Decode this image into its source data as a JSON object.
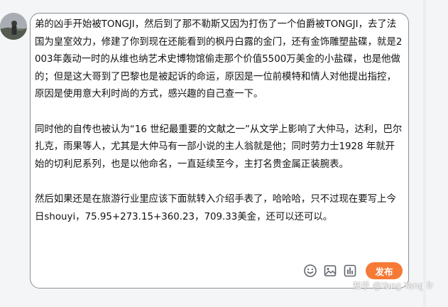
{
  "editor": {
    "paragraphs": [
      "弟的凶手开始被TONGJI，然后到了那不勒斯又因为打伤了一个伯爵被TONGJI，去了法国为皇室效力，修建了你到现在还能看到的枫丹白露的金门，还有金饰雕塑盐碟，就是2003年轰动一时的从维也纳艺术史博物馆偷走那个价值5500万美金的小盐碟，也是他做的；但是这大哥到了巴黎也是被起诉的命运，原因是一位前模特和情人对他提出指控，原因是使用意大利时尚的方式，感兴趣的自己查一下。",
      "同时他的自传也被认为“16 世纪最重要的文献之一”从文学上影响了大仲马，达利，巴尔扎克，雨果等人，尤其是大仲马有一部小说的主人翁就是他；同时劳力士1928 年就开始的切利尼系列，也是以他命名，一直延续至今，主打名贵金属正装腕表。",
      "然后如果还是在旅游行业里应该下面就转入介绍手表了，哈哈哈，只不过现在要写上今日shouyi，75.95+273.15+360.23，709.33美金，还可以还可以。"
    ]
  },
  "toolbar": {
    "icons": [
      "emoji-icon",
      "image-icon",
      "chart-icon"
    ],
    "publish_label": "发布"
  },
  "watermark": {
    "text": "知乎 @Yang Yang fr"
  },
  "colors": {
    "publish": "#f57a35",
    "border": "#8a8f95",
    "text": "#121212"
  }
}
